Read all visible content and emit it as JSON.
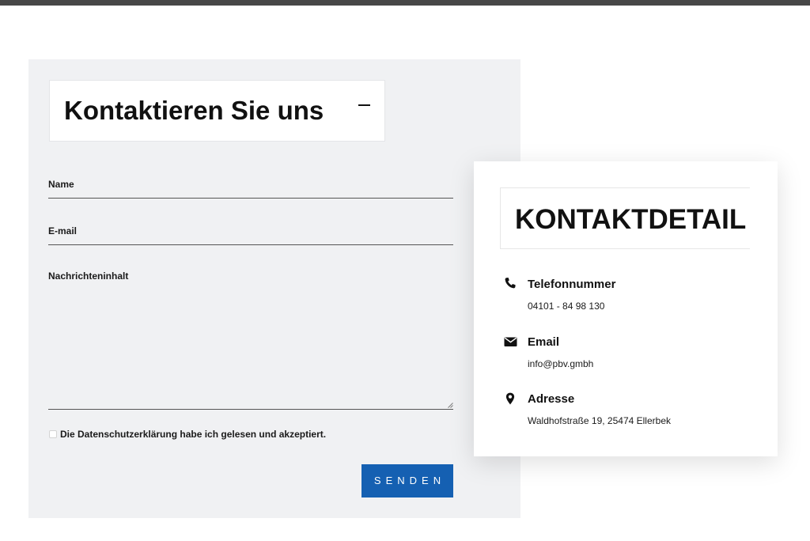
{
  "form": {
    "title": "Kontaktieren Sie uns",
    "fields": {
      "name_label": "Name",
      "email_label": "E-mail",
      "message_label": "Nachrichteninhalt"
    },
    "consent_label": "Die Datenschutzerklärung habe ich gelesen und akzeptiert.",
    "submit_label": "SENDEN"
  },
  "contact_card": {
    "title": "KONTAKTDETAIL",
    "items": [
      {
        "heading": "Telefonnummer",
        "value": "04101 - 84 98 130",
        "icon": "phone-icon"
      },
      {
        "heading": "Email",
        "value": "info@pbv.gmbh",
        "icon": "envelope-icon"
      },
      {
        "heading": "Adresse",
        "value": "Waldhofstraße 19, 25474 Ellerbek",
        "icon": "map-pin-icon"
      }
    ]
  },
  "colors": {
    "top_bar": "#474747",
    "form_background": "#f0f1f3",
    "button": "#1560b2",
    "text": "#111111"
  }
}
